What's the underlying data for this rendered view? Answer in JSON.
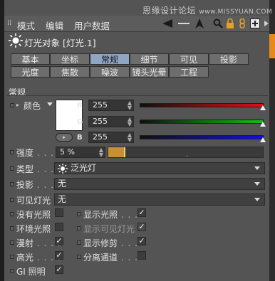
{
  "watermark": {
    "text": "思缘设计论坛",
    "url": "www.MISSYUAN.COM"
  },
  "menu": {
    "mode": "模式",
    "edit": "编辑",
    "user_data": "用户数据"
  },
  "object": {
    "title": "灯光对象 [灯光.1]"
  },
  "tabs_row1": [
    "基本",
    "坐标",
    "常规",
    "细节",
    "可见",
    "投影"
  ],
  "tabs_row2": [
    "光度",
    "焦散",
    "噪波",
    "镜头光晕",
    "工程"
  ],
  "active_tab": "常规",
  "section": "常规",
  "color": {
    "label": "颜色",
    "r_label": "R",
    "g_label": "G",
    "b_label": "B",
    "r": "255",
    "g": "255",
    "b": "255",
    "swatch": "#ffffff"
  },
  "intensity": {
    "label": "强度",
    "value": "5 %",
    "fraction": 0.05
  },
  "type": {
    "label": "类型",
    "value": "泛光灯"
  },
  "shadow": {
    "label": "投影",
    "value": "无"
  },
  "visible_light": {
    "label": "可见灯光",
    "value": "无"
  },
  "checks": {
    "no_illum": {
      "label": "没有光照",
      "checked": false
    },
    "show_illum": {
      "label": "显示光照",
      "checked": true
    },
    "ambient": {
      "label": "环境光照",
      "checked": false
    },
    "show_visible": {
      "label": "显示可见灯光",
      "checked": true
    },
    "diffuse": {
      "label": "漫射",
      "checked": true
    },
    "show_clipping": {
      "label": "显示修剪",
      "checked": true
    },
    "specular": {
      "label": "高光",
      "checked": true
    },
    "separate_pass": {
      "label": "分离通道",
      "checked": false
    },
    "gi": {
      "label": "GI 照明",
      "checked": true
    }
  },
  "colors": {
    "red": "#e01010",
    "green": "#10c010",
    "blue": "#1010e0",
    "accent": "#e88a1a",
    "active_tab": "#8fa5c2"
  }
}
